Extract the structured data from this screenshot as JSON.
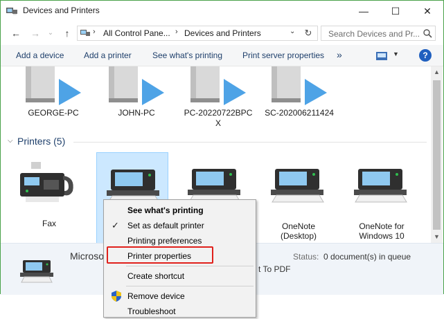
{
  "window": {
    "title": "Devices and Printers"
  },
  "window_controls": {
    "minimize": "—",
    "maximize": "☐",
    "close": "✕"
  },
  "address": {
    "crumb1": "All Control Pane...",
    "crumb2": "Devices and Printers",
    "search_placeholder": "Search Devices and Pr..."
  },
  "toolbar": {
    "add_device": "Add a device",
    "add_printer": "Add a printer",
    "see_printing": "See what's printing",
    "print_server": "Print server properties",
    "more": "»",
    "help": "?"
  },
  "computers": [
    {
      "label": "GEORGE-PC"
    },
    {
      "label": "JOHN-PC"
    },
    {
      "label": "PC-20220722BPC",
      "label2": "X"
    },
    {
      "label": "SC-202006211424"
    }
  ],
  "printers_group": {
    "label": "Printers (5)"
  },
  "printers": [
    {
      "label": "Fax",
      "label2": ""
    },
    {
      "label": "",
      "label2": ""
    },
    {
      "label": "",
      "label2": ""
    },
    {
      "label": "OneNote",
      "label2": "(Desktop)"
    },
    {
      "label": "OneNote for",
      "label2": "Windows 10"
    }
  ],
  "details": {
    "name": "Microsof",
    "status_label": "Status:",
    "status_value": "0 document(s) in queue",
    "partial": "t To PDF"
  },
  "context_menu": {
    "see_printing": "See what's printing",
    "set_default": "Set as default printer",
    "printing_prefs": "Printing preferences",
    "printer_props": "Printer properties",
    "create_shortcut": "Create shortcut",
    "remove_device": "Remove device",
    "troubleshoot": "Troubleshoot",
    "check_glyph": "✓"
  },
  "colors": {
    "accent": "#1e3f6b",
    "selection": "#cce8ff",
    "highlight_box": "#e0201b",
    "arrow": "#4ea3e6"
  }
}
